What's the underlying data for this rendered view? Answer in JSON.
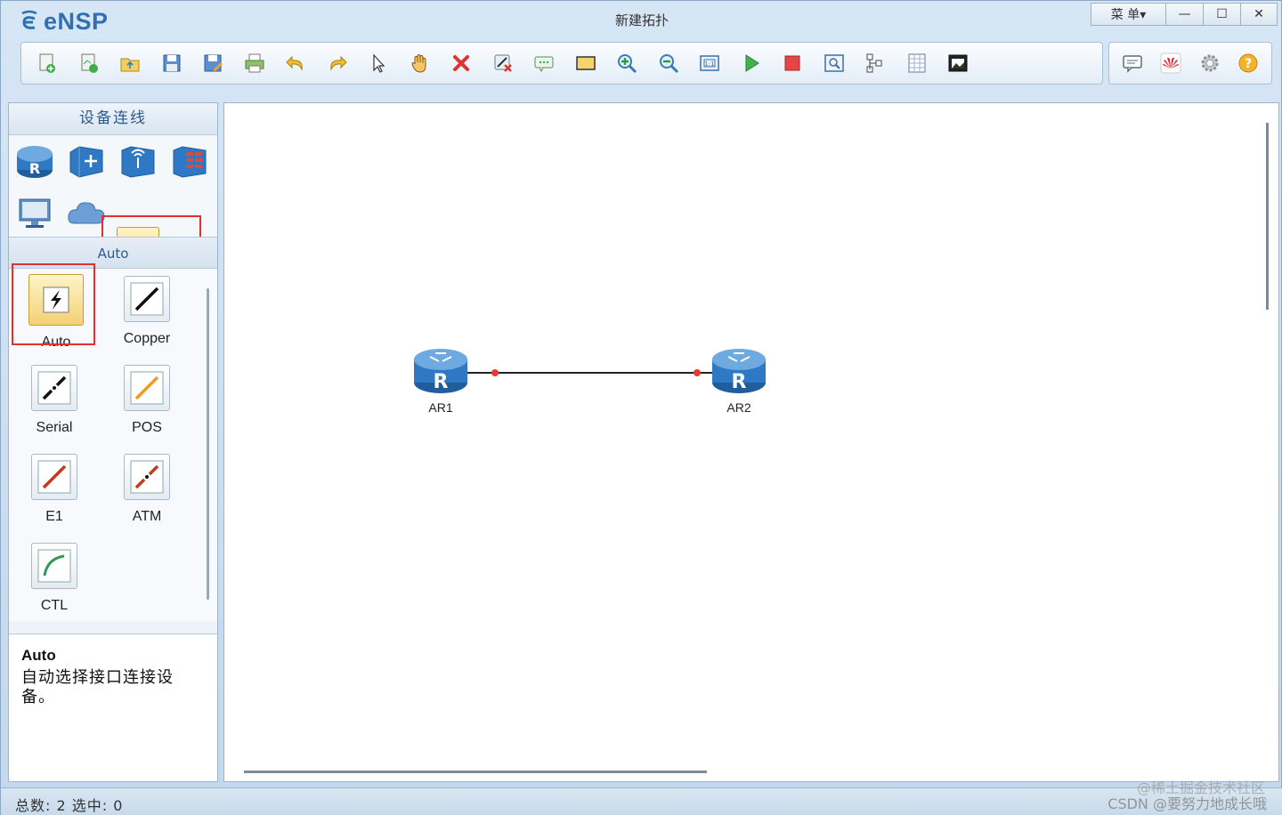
{
  "app": {
    "name": "eNSP",
    "window_title": "新建拓扑"
  },
  "window_controls": {
    "menu_label": "菜 单▾",
    "minimize": "—",
    "maximize": "☐",
    "close": "✕"
  },
  "toolbar": {
    "tools": [
      "new-topology-icon",
      "new-example-icon",
      "open-icon",
      "save-icon",
      "save-as-icon",
      "print-icon",
      "undo-icon",
      "redo-icon",
      "select-icon",
      "hand-icon",
      "delete-icon",
      "delete-link-icon",
      "text-icon",
      "rectangle-icon",
      "zoom-in-icon",
      "zoom-out-icon",
      "fit-icon",
      "start-icon",
      "stop-icon",
      "capture-icon",
      "topology-icon",
      "grid-icon",
      "screenshot-icon"
    ],
    "right_tools": [
      "chat-icon",
      "huawei-icon",
      "settings-icon",
      "help-icon"
    ]
  },
  "left_panel": {
    "header": "设备连线",
    "devices": [
      "router-icon",
      "switch-icon",
      "wireless-icon",
      "firewall-icon",
      "pc-icon",
      "cloud-icon",
      "cable-auto-icon"
    ],
    "category_label": "Auto",
    "cables": [
      {
        "label": "Auto",
        "icon": "auto-cable-icon",
        "active": true
      },
      {
        "label": "Copper",
        "icon": "copper-cable-icon",
        "active": false
      },
      {
        "label": "Serial",
        "icon": "serial-cable-icon",
        "active": false
      },
      {
        "label": "POS",
        "icon": "pos-cable-icon",
        "active": false
      },
      {
        "label": "E1",
        "icon": "e1-cable-icon",
        "active": false
      },
      {
        "label": "ATM",
        "icon": "atm-cable-icon",
        "active": false
      },
      {
        "label": "CTL",
        "icon": "ctl-cable-icon",
        "active": false
      }
    ],
    "description": {
      "title": "Auto",
      "text": "自动选择接口连接设备。"
    }
  },
  "topology": {
    "nodes": [
      {
        "label": "AR1",
        "glyph": "R"
      },
      {
        "label": "AR2",
        "glyph": "R"
      }
    ]
  },
  "status": {
    "text": "总数: 2 选中: 0"
  },
  "watermark": {
    "line1": "@稀土掘金技术社区",
    "line2": "CSDN @要努力地成长哦"
  },
  "colors": {
    "accent": "#2f6fb4",
    "selection": "#e03030",
    "link_endpoint": "#e53935"
  }
}
